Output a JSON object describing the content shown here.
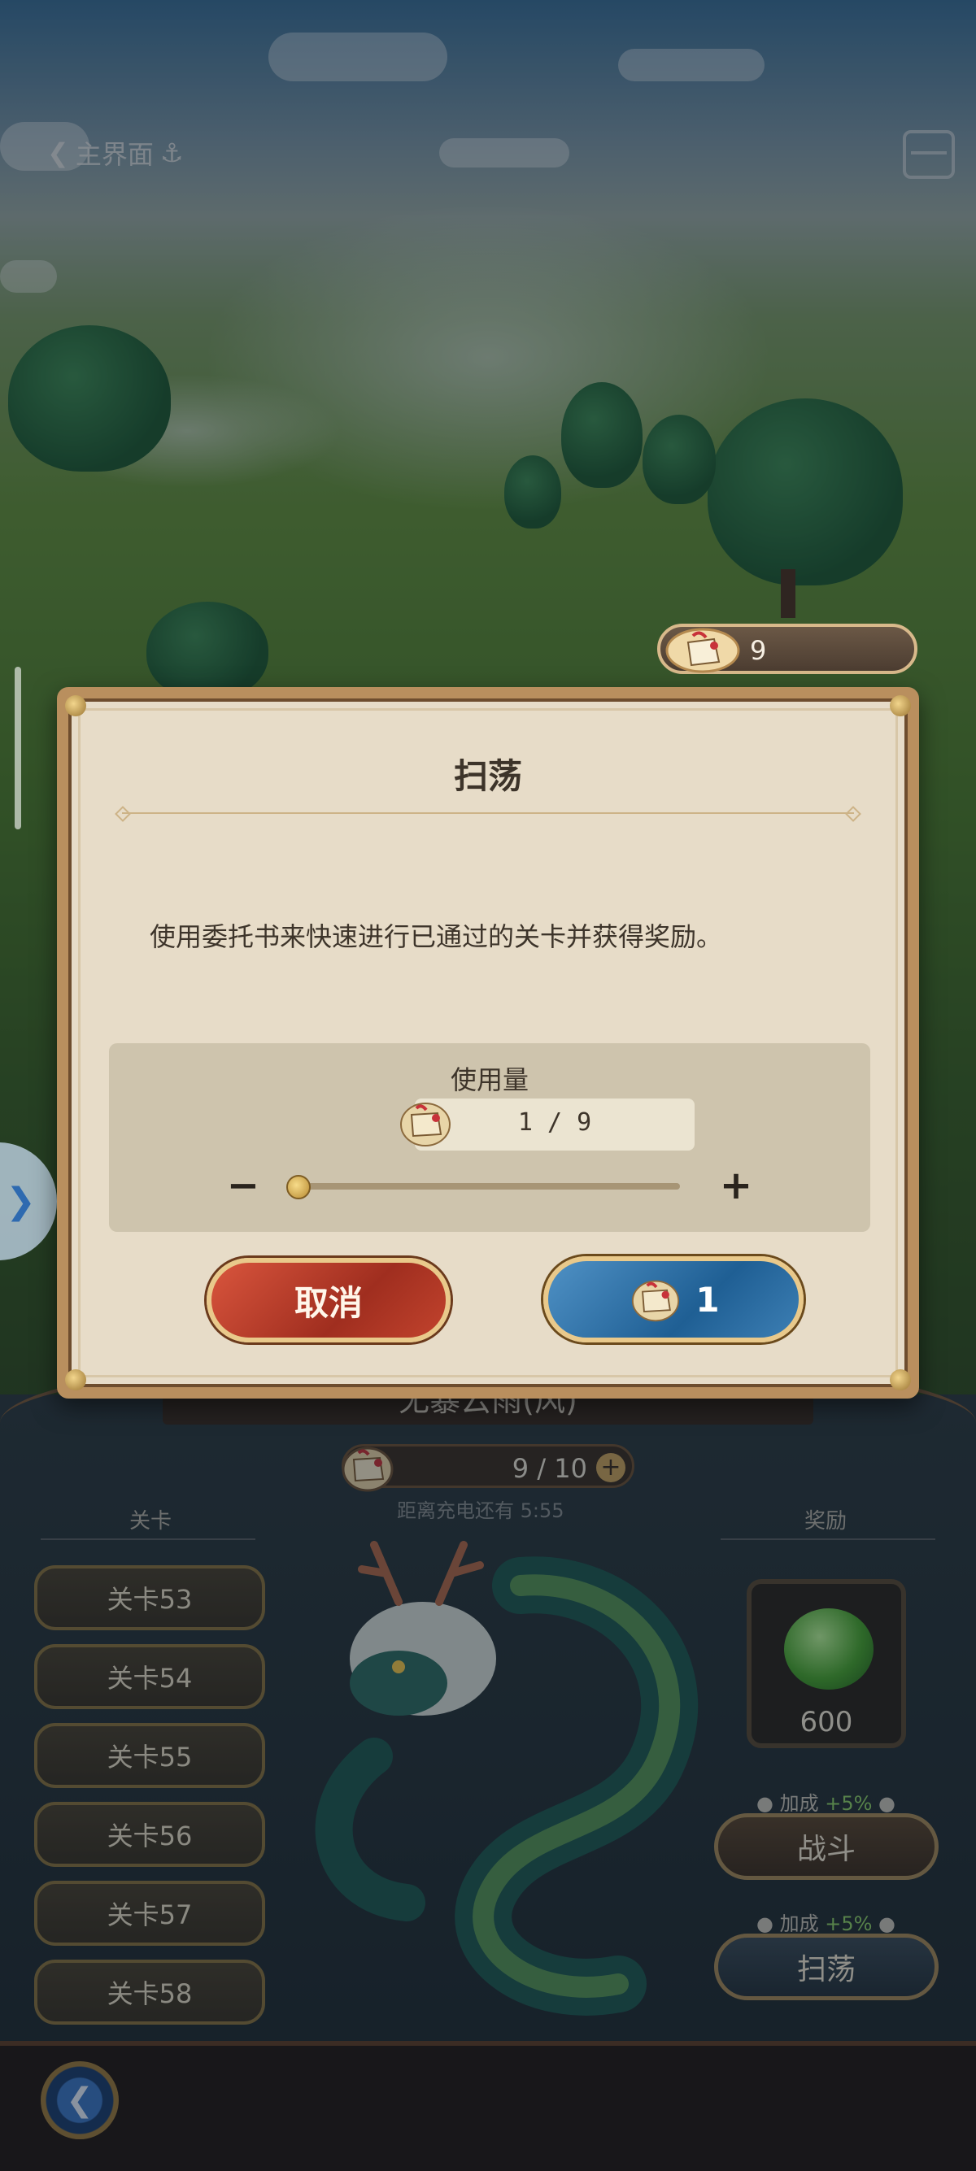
{
  "top_bar": {
    "back_label": "主界面"
  },
  "resource": {
    "icon": "commission-book-icon",
    "count": "9"
  },
  "dialog": {
    "title": "扫荡",
    "description": "使用委托书来快速进行已通过的关卡并获得奖励。",
    "usage_label": "使用量",
    "quantity_display": "1 / 9",
    "quantity": 1,
    "max_quantity": 9,
    "slider_fraction": 0.0,
    "cancel_label": "取消",
    "confirm_amount": "1"
  },
  "panel": {
    "stage_title": "无暴云雨(风)",
    "energy": "9 / 10",
    "recharge_text": "距离充电还有 5:55",
    "stages_header": "关卡",
    "rewards_header": "奖励",
    "stages": [
      "关卡53",
      "关卡54",
      "关卡55",
      "关卡56",
      "关卡57",
      "关卡58"
    ],
    "reward_amount": "600",
    "bonus_fight": "加成",
    "bonus_fight_pct": "+5%",
    "bonus_sweep": "加成",
    "bonus_sweep_pct": "+5%",
    "fight_label": "战斗",
    "sweep_label": "扫荡"
  },
  "colors": {
    "cancel": "#c2432d",
    "confirm": "#2f73a8",
    "frame": "#b98f5e"
  }
}
